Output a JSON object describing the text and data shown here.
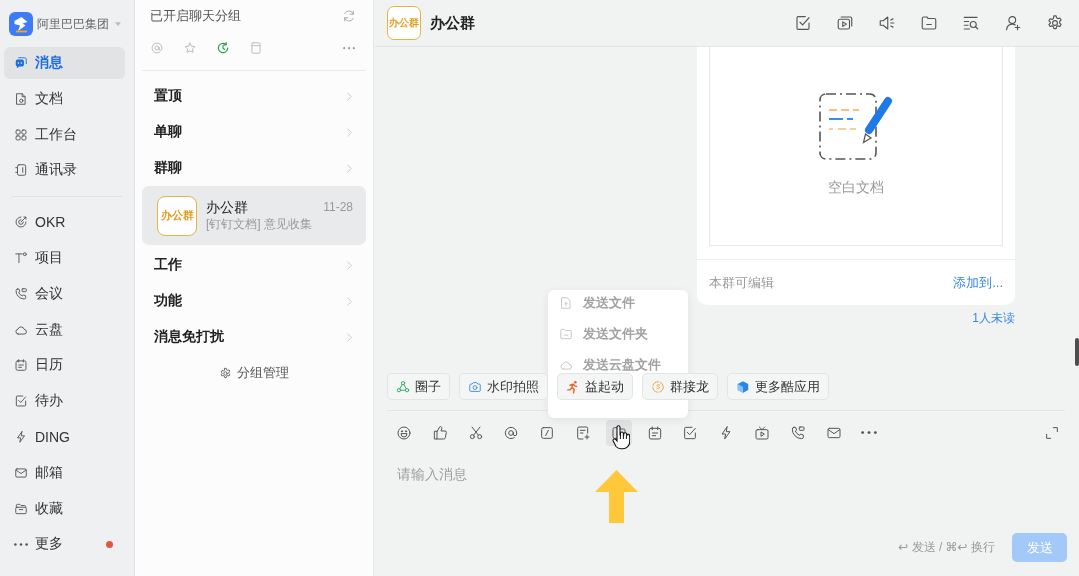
{
  "sidebar": {
    "org": {
      "name": "阿里巴巴集团"
    },
    "sections": [
      {
        "items": [
          {
            "label": "消息",
            "selected": true,
            "dot": false
          },
          {
            "label": "文档",
            "selected": false,
            "dot": false
          },
          {
            "label": "工作台",
            "selected": false,
            "dot": false
          },
          {
            "label": "通讯录",
            "selected": false,
            "dot": false
          }
        ]
      },
      {
        "items": [
          {
            "label": "OKR",
            "selected": false,
            "dot": false
          },
          {
            "label": "项目",
            "selected": false,
            "dot": false
          },
          {
            "label": "会议",
            "selected": false,
            "dot": false
          },
          {
            "label": "云盘",
            "selected": false,
            "dot": false
          },
          {
            "label": "日历",
            "selected": false,
            "dot": false
          },
          {
            "label": "待办",
            "selected": false,
            "dot": false
          },
          {
            "label": "DING",
            "selected": false,
            "dot": false
          },
          {
            "label": "邮箱",
            "selected": false,
            "dot": false
          },
          {
            "label": "收藏",
            "selected": false,
            "dot": false
          },
          {
            "label": "更多",
            "selected": false,
            "dot": true
          }
        ]
      }
    ]
  },
  "chat_list": {
    "title": "已开启聊天分组",
    "filters": [
      {
        "selected": false
      },
      {
        "selected": false
      },
      {
        "selected": true
      },
      {
        "selected": false
      }
    ],
    "groups": [
      {
        "label": "置顶"
      },
      {
        "label": "单聊"
      },
      {
        "label": "群聊",
        "chats": [
          {
            "avatar_text": "办公群",
            "name": "办公群",
            "time": "11-28",
            "preview": "[钉钉文档] 意见收集",
            "selected": true
          }
        ]
      },
      {
        "label": "工作"
      },
      {
        "label": "功能"
      },
      {
        "label": "消息免打扰"
      }
    ],
    "manage_button": "分组管理"
  },
  "conversation": {
    "avatar_text": "办公群",
    "title": "办公群",
    "doc_card": {
      "title": "空白文档",
      "permission": "本群可编辑",
      "action": "添加到...",
      "read_status": "1人未读"
    },
    "file_menu": {
      "items": [
        {
          "label": "发送文件"
        },
        {
          "label": "发送文件夹"
        },
        {
          "label": "发送云盘文件"
        }
      ]
    },
    "apps": [
      {
        "label": "圈子"
      },
      {
        "label": "水印拍照"
      },
      {
        "label": "益起动"
      },
      {
        "label": "群接龙"
      },
      {
        "label": "更多酷应用"
      }
    ],
    "toolbar": {
      "tools": [
        {
          "hovered": false
        },
        {
          "hovered": false
        },
        {
          "hovered": false
        },
        {
          "hovered": false
        },
        {
          "hovered": false
        },
        {
          "hovered": false
        },
        {
          "hovered": true
        },
        {
          "hovered": false
        },
        {
          "hovered": false
        },
        {
          "hovered": false
        },
        {
          "hovered": false
        },
        {
          "hovered": false
        },
        {
          "hovered": false
        },
        {
          "hovered": false
        }
      ]
    },
    "composer": {
      "placeholder": "请输入消息",
      "hint": "↩ 发送 / ⌘↩ 换行",
      "send_button": {
        "label": "发送",
        "disabled": true
      }
    }
  }
}
